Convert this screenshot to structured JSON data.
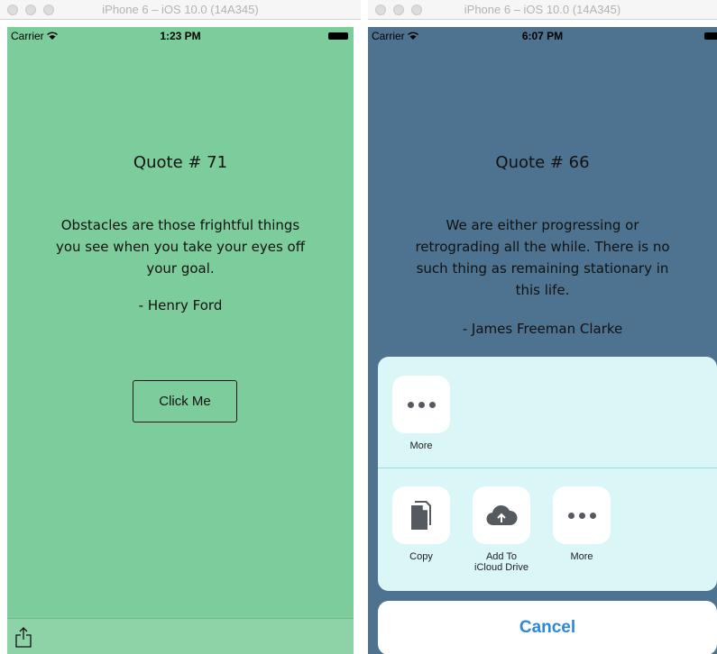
{
  "left": {
    "window_title": "iPhone 6 – iOS 10.0 (14A345)",
    "status": {
      "carrier": "Carrier",
      "time": "1:23 PM"
    },
    "quote": {
      "title": "Quote # 71",
      "text": "Obstacles are those frightful things you see when you take your eyes off your goal.",
      "author": "- Henry Ford"
    },
    "button_label": "Click Me",
    "background_color": "#7dcd9c",
    "toolbar_icon": "share-icon"
  },
  "right": {
    "window_title": "iPhone 6 – iOS 10.0 (14A345)",
    "status": {
      "carrier": "Carrier",
      "time": "6:07 PM"
    },
    "quote": {
      "title": "Quote # 66",
      "text": "We are either progressing or retrograding all the while. There is no such thing as remaining stationary in this life.",
      "author": "- James Freeman Clarke"
    },
    "background_color": "#4d7390",
    "share_sheet": {
      "top_row": [
        {
          "label": "More",
          "icon": "more-icon"
        }
      ],
      "bottom_row": [
        {
          "label": "Copy",
          "icon": "copy-icon"
        },
        {
          "label": "Add To\niCloud Drive",
          "line1": "Add To",
          "line2": "iCloud Drive",
          "icon": "icloud-upload-icon"
        },
        {
          "label": "More",
          "icon": "more-icon"
        }
      ],
      "cancel_label": "Cancel",
      "accent_color": "#2c88d9"
    }
  }
}
